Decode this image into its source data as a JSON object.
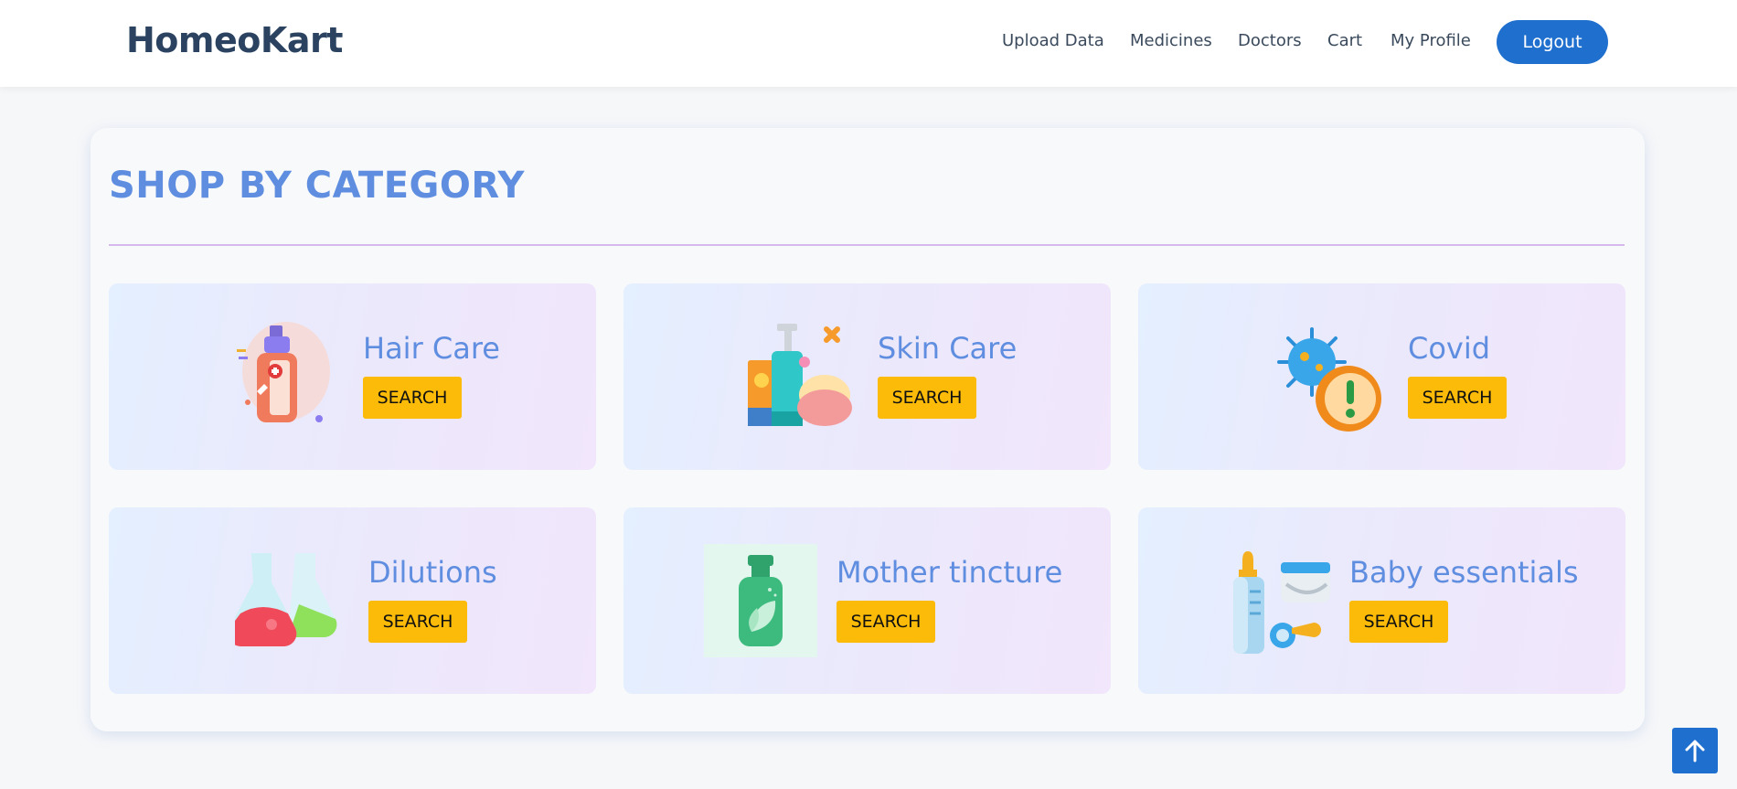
{
  "brand": {
    "name": "HomeoKart"
  },
  "nav": {
    "items": [
      {
        "label": "Upload Data"
      },
      {
        "label": "Medicines"
      },
      {
        "label": "Doctors"
      },
      {
        "label": "Cart"
      },
      {
        "label": "My Profile"
      }
    ],
    "logout_label": "Logout"
  },
  "section": {
    "title": "SHOP BY CATEGORY"
  },
  "categories": [
    {
      "name": "Hair Care",
      "button": "SEARCH",
      "icon": "hair-care-bottle-icon"
    },
    {
      "name": "Skin Care",
      "button": "SEARCH",
      "icon": "skin-care-products-icon"
    },
    {
      "name": "Covid",
      "button": "SEARCH",
      "icon": "virus-warning-icon"
    },
    {
      "name": "Dilutions",
      "button": "SEARCH",
      "icon": "flasks-icon"
    },
    {
      "name": "Mother tincture",
      "button": "SEARCH",
      "icon": "tincture-bottle-icon"
    },
    {
      "name": "Baby essentials",
      "button": "SEARCH",
      "icon": "baby-bottle-diaper-icon"
    }
  ],
  "colors": {
    "brand_text": "#2b4360",
    "accent_blue": "#1f6fcf",
    "title_blue": "#5f8ee0",
    "button_yellow": "#fbbb08",
    "divider": "#d7b8ec"
  },
  "scroll_top_icon": "arrow-up-icon"
}
